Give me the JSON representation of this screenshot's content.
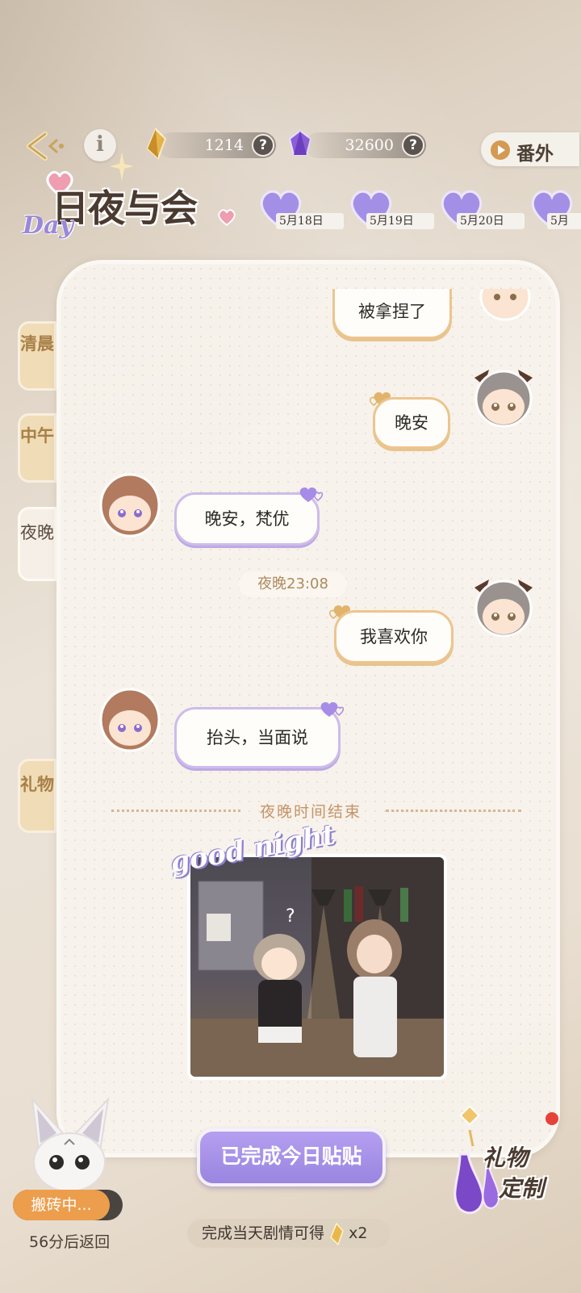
{
  "currency": [
    {
      "name": "amber-gem",
      "value": "1214",
      "help": "?"
    },
    {
      "name": "purple-gem",
      "value": "32600",
      "help": "?"
    }
  ],
  "extra_button": "番外",
  "logo": {
    "title": "日夜与会",
    "accent": "Day"
  },
  "dates": [
    "5月18日",
    "5月19日",
    "5月20日",
    "5月"
  ],
  "side_tabs": [
    "清晨",
    "中午",
    "夜晚"
  ],
  "gift_tab": "礼物",
  "chat": {
    "msg1": "被拿捏了",
    "msg2": "晚安",
    "msg3": "晚安，梵优",
    "time": "夜晚23:08",
    "msg4": "我喜欢你",
    "msg5": "抬头，当面说",
    "end": "夜晚时间结束"
  },
  "sticker_caption": "good night",
  "done_button": "已完成今日贴贴",
  "reward": {
    "text": "完成当天剧情可得",
    "count": "x2"
  },
  "pet": {
    "status": "搬砖中...",
    "return": "56分后返回"
  },
  "gift_custom": {
    "line1": "礼物",
    "line2": "定制"
  },
  "colors": {
    "accent_purple": "#9a85e0",
    "accent_gold": "#d49a52",
    "bubble_right": "#ecc58e",
    "bubble_left": "#cdbcea"
  }
}
